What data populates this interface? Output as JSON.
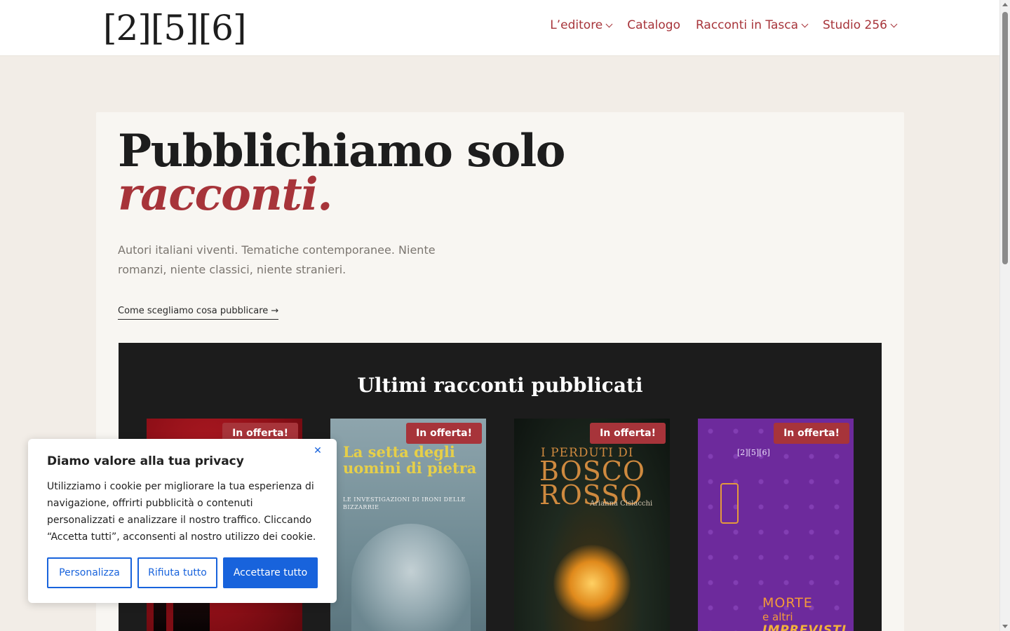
{
  "header": {
    "logo": "[2][5][6]",
    "nav": [
      {
        "label": "L’editore",
        "has_dropdown": true
      },
      {
        "label": "Catalogo",
        "has_dropdown": false
      },
      {
        "label": "Racconti in Tasca",
        "has_dropdown": true
      },
      {
        "label": "Studio 256",
        "has_dropdown": true
      }
    ]
  },
  "hero": {
    "title_line1": "Pubblichiamo solo",
    "title_line2": "racconti.",
    "subtitle": "Autori italiani viventi. Tematiche contemporanee. Niente romanzi, niente classici, niente stranieri.",
    "link": "Come scegliamo cosa pubblicare →"
  },
  "latest": {
    "title": "Ultimi racconti pubblicati",
    "books": [
      {
        "badge": "In offerta!"
      },
      {
        "badge": "In offerta!",
        "cover_title": "La setta degli uomini di pietra",
        "cover_subtitle": "LE INVESTIGAZIONI DI IRONI DELLE BIZZARRIE"
      },
      {
        "badge": "In offerta!",
        "cover_title_top": "I PERDUTI DI",
        "cover_title_big": "BOSCO ROSSO",
        "cover_author": "Arianna Cislacchi"
      },
      {
        "badge": "In offerta!",
        "cover_logo": "[2][5][6]",
        "cover_title_1": "MORTE",
        "cover_title_2": "e altri",
        "cover_title_3": "IMPREVISTI"
      }
    ]
  },
  "cookie": {
    "title": "Diamo valore alla tua privacy",
    "text": "Utilizziamo i cookie per migliorare la tua esperienza di navigazione, offrirti pubblicità o contenuti personalizzati e analizzare il nostro traffico. Cliccando “Accetta tutti”, acconsenti al nostro utilizzo dei cookie.",
    "close_icon": "close-icon",
    "buttons": {
      "customize": "Personalizza",
      "reject": "Rifiuta tutto",
      "accept": "Accettare tutto"
    }
  },
  "colors": {
    "accent": "#a7343a",
    "cookie_blue": "#1863dc",
    "page_bg": "#f2ede7",
    "dark_section": "#1c1c1c"
  }
}
